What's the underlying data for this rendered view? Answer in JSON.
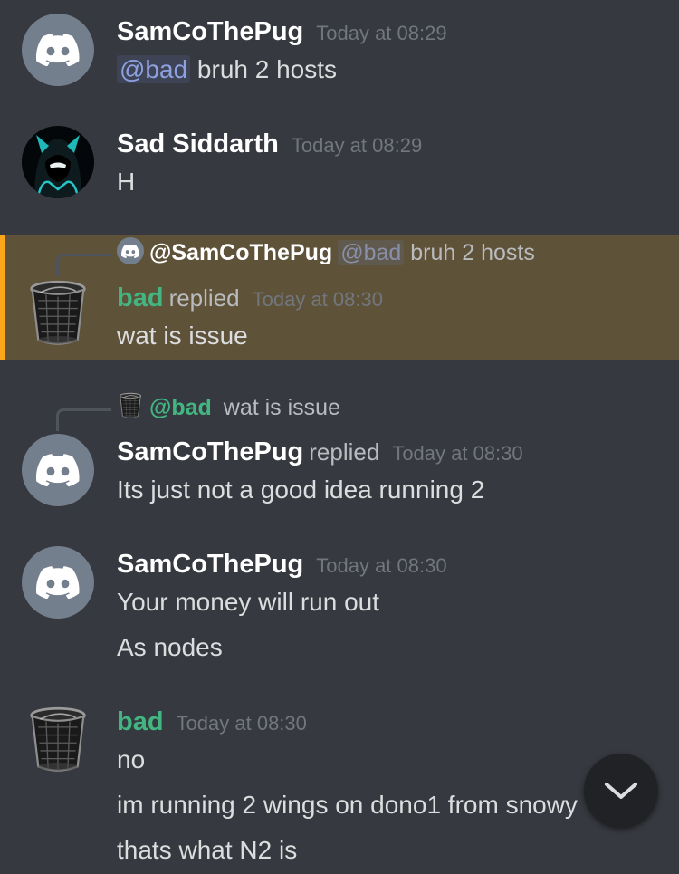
{
  "messages": [
    {
      "author": "SamCoThePug",
      "timestamp": "Today at 08:29",
      "mention": "@bad",
      "text": " bruh 2 hosts"
    },
    {
      "author": "Sad Siddarth",
      "timestamp": "Today at 08:29",
      "text": "H"
    },
    {
      "reply_to": {
        "author": "@SamCoThePug",
        "mention": "@bad",
        "text": "bruh 2 hosts"
      },
      "author": "bad",
      "replied_label": "replied",
      "timestamp": "Today at 08:30",
      "text": "wat is issue"
    },
    {
      "reply_to": {
        "author": "@bad",
        "text": "wat is issue"
      },
      "author": "SamCoThePug",
      "replied_label": "replied",
      "timestamp": "Today at 08:30",
      "text": "Its just not a good idea running 2"
    },
    {
      "author": "SamCoThePug",
      "timestamp": "Today at 08:30",
      "lines": [
        "Your money will run out",
        "As nodes"
      ]
    },
    {
      "author": "bad",
      "timestamp": "Today at 08:30",
      "lines": [
        "no",
        "im running 2 wings on dono1 from snowy",
        "thats what N2 is"
      ]
    }
  ],
  "icons": {
    "avatar_default": "discord-logo-icon",
    "avatar_hacker": "hooded-figure-icon",
    "avatar_trash": "trash-can-icon",
    "scroll": "chevron-down-icon"
  },
  "colors": {
    "background": "#36393f",
    "highlight": "#5e5239",
    "highlight_bar": "#faa61a",
    "username_green": "#43b581",
    "mention": "#8ea1e1",
    "timestamp": "#72767d"
  }
}
